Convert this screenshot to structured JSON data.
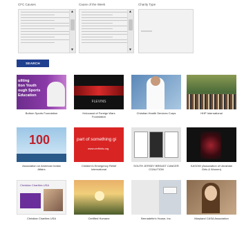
{
  "filters": {
    "cfc_causes": {
      "label": "CFC Causes"
    },
    "cause_of_week": {
      "label": "Cause of the Week"
    },
    "charity_type": {
      "label": "Charity Type"
    }
  },
  "search": {
    "label": "SEARCH"
  },
  "charities": [
    {
      "name": "Bottom Sports Foundation",
      "thumb_text": "uilting\ntion Youth\nough Sports\nEducation"
    },
    {
      "name": "Holocaust of Foreign Wars\nFoundation",
      "thumb_text": "FLEVINS"
    },
    {
      "name": "Christian Health Services Corps",
      "thumb_text": ""
    },
    {
      "name": "HHP International",
      "thumb_text": ""
    },
    {
      "name": "Association on American Indian\nAffairs",
      "thumb_text": "100"
    },
    {
      "name": "Children's Emergency Relief\nInternational",
      "thumb_text": "part of something gi",
      "thumb_url": "www.cerfkids.org"
    },
    {
      "name": "SOUTH JERSEY BREAST CANCER\nCOALITION",
      "thumb_text": ""
    },
    {
      "name": "KASOW (Association of Ukrainian\nGirls & Women)",
      "thumb_text": ""
    },
    {
      "name": "Christian Charities USA",
      "thumb_text": "Christian Charities USA"
    },
    {
      "name": "Certified Humane",
      "thumb_text": ""
    },
    {
      "name": "Bernadette's House, Inc.",
      "thumb_text": ""
    },
    {
      "name": "Maryland CASA Association",
      "thumb_text": ""
    }
  ],
  "colors": {
    "search_button": "#1f3f8f"
  }
}
